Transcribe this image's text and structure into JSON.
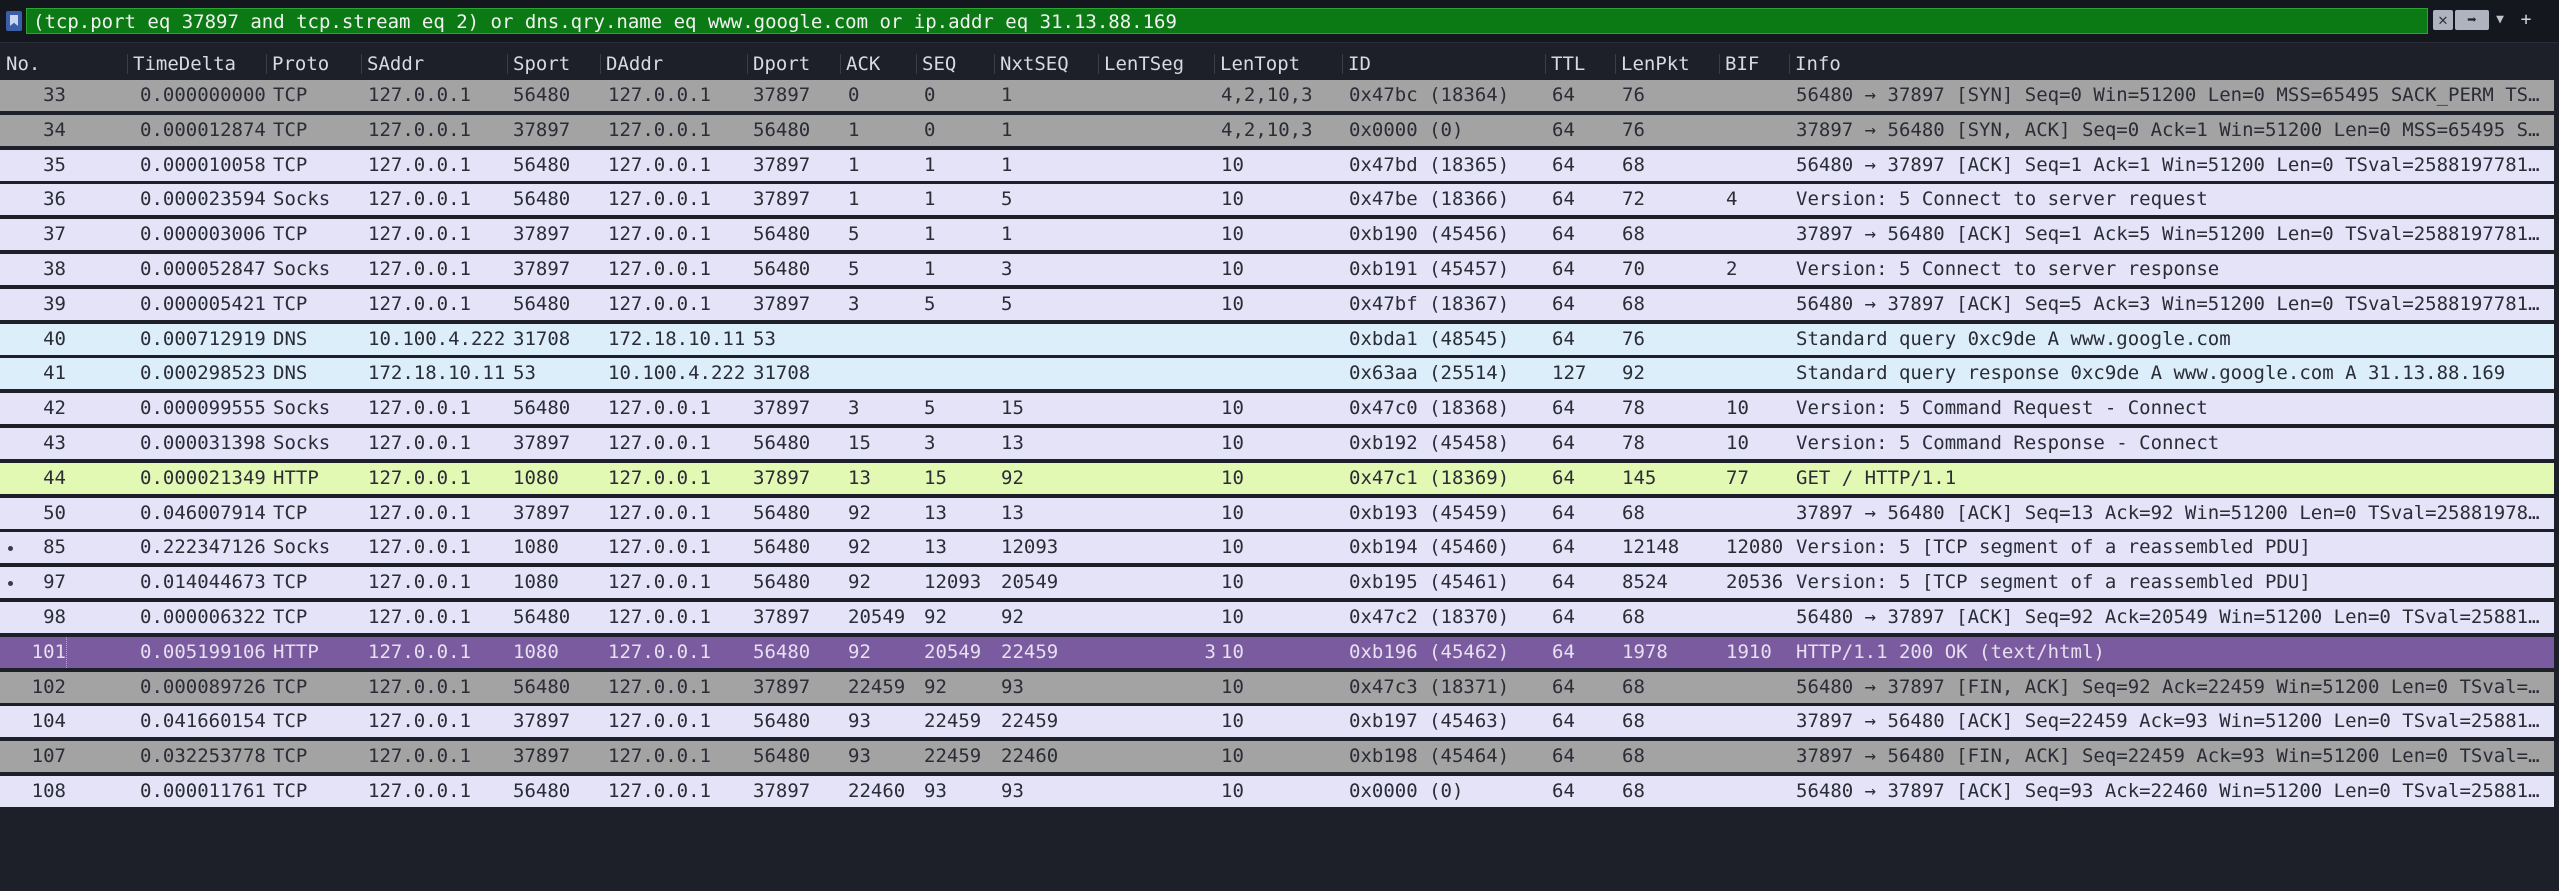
{
  "filter": {
    "value": "(tcp.port eq 37897 and tcp.stream eq 2) or dns.qry.name eq www.google.com or ip.addr eq 31.13.88.169",
    "clear_icon": "clear-icon",
    "apply_icon": "apply-arrow-icon",
    "dropdown_icon": "chevron-down-icon",
    "add_icon": "plus-icon"
  },
  "columns": [
    "No.",
    "TimeDelta",
    "Proto",
    "SAddr",
    "Sport",
    "DAddr",
    "Dport",
    "ACK",
    "SEQ",
    "NxtSEQ",
    "LenTSeg",
    "LenTopt",
    "ID",
    "TTL",
    "LenPkt",
    "BIF",
    "Info"
  ],
  "colors": {
    "tcp": "#e4e3f8",
    "tcp_syn_fin": "#a3a3a3",
    "dns": "#dbeefa",
    "http": "#e2f9b4",
    "selected": "#7a5ba0",
    "filter_valid": "#0c7a14"
  },
  "packets": [
    {
      "no": "33",
      "td": "0.000000000",
      "proto": "TCP",
      "saddr": "127.0.0.1",
      "sport": "56480",
      "daddr": "127.0.0.1",
      "dport": "37897",
      "ack": "0",
      "seq": "0",
      "nxt": "1",
      "lents": "",
      "lento": "4,2,10,3",
      "id": "0x47bc (18364)",
      "ttl": "64",
      "lenpkt": "76",
      "bif": "",
      "info": "56480 → 37897 [SYN] Seq=0 Win=51200 Len=0 MSS=65495 SACK_PERM TS…",
      "style": "syn",
      "mark": false
    },
    {
      "no": "34",
      "td": "0.000012874",
      "proto": "TCP",
      "saddr": "127.0.0.1",
      "sport": "37897",
      "daddr": "127.0.0.1",
      "dport": "56480",
      "ack": "1",
      "seq": "0",
      "nxt": "1",
      "lents": "",
      "lento": "4,2,10,3",
      "id": "0x0000 (0)",
      "ttl": "64",
      "lenpkt": "76",
      "bif": "",
      "info": "37897 → 56480 [SYN, ACK] Seq=0 Ack=1 Win=51200 Len=0 MSS=65495 S…",
      "style": "syn",
      "mark": false
    },
    {
      "no": "35",
      "td": "0.000010058",
      "proto": "TCP",
      "saddr": "127.0.0.1",
      "sport": "56480",
      "daddr": "127.0.0.1",
      "dport": "37897",
      "ack": "1",
      "seq": "1",
      "nxt": "1",
      "lents": "",
      "lento": "10",
      "id": "0x47bd (18365)",
      "ttl": "64",
      "lenpkt": "68",
      "bif": "",
      "info": "56480 → 37897 [ACK] Seq=1 Ack=1 Win=51200 Len=0 TSval=2588197781…",
      "style": "tcp",
      "mark": false
    },
    {
      "no": "36",
      "td": "0.000023594",
      "proto": "Socks",
      "saddr": "127.0.0.1",
      "sport": "56480",
      "daddr": "127.0.0.1",
      "dport": "37897",
      "ack": "1",
      "seq": "1",
      "nxt": "5",
      "lents": "",
      "lento": "10",
      "id": "0x47be (18366)",
      "ttl": "64",
      "lenpkt": "72",
      "bif": "4",
      "info": "Version: 5 Connect to server request",
      "style": "tcp",
      "mark": false
    },
    {
      "no": "37",
      "td": "0.000003006",
      "proto": "TCP",
      "saddr": "127.0.0.1",
      "sport": "37897",
      "daddr": "127.0.0.1",
      "dport": "56480",
      "ack": "5",
      "seq": "1",
      "nxt": "1",
      "lents": "",
      "lento": "10",
      "id": "0xb190 (45456)",
      "ttl": "64",
      "lenpkt": "68",
      "bif": "",
      "info": "37897 → 56480 [ACK] Seq=1 Ack=5 Win=51200 Len=0 TSval=2588197781…",
      "style": "tcp",
      "mark": false
    },
    {
      "no": "38",
      "td": "0.000052847",
      "proto": "Socks",
      "saddr": "127.0.0.1",
      "sport": "37897",
      "daddr": "127.0.0.1",
      "dport": "56480",
      "ack": "5",
      "seq": "1",
      "nxt": "3",
      "lents": "",
      "lento": "10",
      "id": "0xb191 (45457)",
      "ttl": "64",
      "lenpkt": "70",
      "bif": "2",
      "info": "Version: 5 Connect to server response",
      "style": "tcp",
      "mark": false
    },
    {
      "no": "39",
      "td": "0.000005421",
      "proto": "TCP",
      "saddr": "127.0.0.1",
      "sport": "56480",
      "daddr": "127.0.0.1",
      "dport": "37897",
      "ack": "3",
      "seq": "5",
      "nxt": "5",
      "lents": "",
      "lento": "10",
      "id": "0x47bf (18367)",
      "ttl": "64",
      "lenpkt": "68",
      "bif": "",
      "info": "56480 → 37897 [ACK] Seq=5 Ack=3 Win=51200 Len=0 TSval=2588197781…",
      "style": "tcp",
      "mark": false
    },
    {
      "no": "40",
      "td": "0.000712919",
      "proto": "DNS",
      "saddr": "10.100.4.222",
      "sport": "31708",
      "daddr": "172.18.10.11",
      "dport": "53",
      "ack": "",
      "seq": "",
      "nxt": "",
      "lents": "",
      "lento": "",
      "id": "0xbda1 (48545)",
      "ttl": "64",
      "lenpkt": "76",
      "bif": "",
      "info": "Standard query 0xc9de A www.google.com",
      "style": "dns",
      "mark": false
    },
    {
      "no": "41",
      "td": "0.000298523",
      "proto": "DNS",
      "saddr": "172.18.10.11",
      "sport": "53",
      "daddr": "10.100.4.222",
      "dport": "31708",
      "ack": "",
      "seq": "",
      "nxt": "",
      "lents": "",
      "lento": "",
      "id": "0x63aa (25514)",
      "ttl": "127",
      "lenpkt": "92",
      "bif": "",
      "info": "Standard query response 0xc9de A www.google.com A 31.13.88.169",
      "style": "dns",
      "mark": false
    },
    {
      "no": "42",
      "td": "0.000099555",
      "proto": "Socks",
      "saddr": "127.0.0.1",
      "sport": "56480",
      "daddr": "127.0.0.1",
      "dport": "37897",
      "ack": "3",
      "seq": "5",
      "nxt": "15",
      "lents": "",
      "lento": "10",
      "id": "0x47c0 (18368)",
      "ttl": "64",
      "lenpkt": "78",
      "bif": "10",
      "info": "Version: 5 Command Request - Connect",
      "style": "tcp",
      "mark": false
    },
    {
      "no": "43",
      "td": "0.000031398",
      "proto": "Socks",
      "saddr": "127.0.0.1",
      "sport": "37897",
      "daddr": "127.0.0.1",
      "dport": "56480",
      "ack": "15",
      "seq": "3",
      "nxt": "13",
      "lents": "",
      "lento": "10",
      "id": "0xb192 (45458)",
      "ttl": "64",
      "lenpkt": "78",
      "bif": "10",
      "info": "Version: 5 Command Response - Connect",
      "style": "tcp",
      "mark": false
    },
    {
      "no": "44",
      "td": "0.000021349",
      "proto": "HTTP",
      "saddr": "127.0.0.1",
      "sport": "1080",
      "daddr": "127.0.0.1",
      "dport": "37897",
      "ack": "13",
      "seq": "15",
      "nxt": "92",
      "lents": "",
      "lento": "10",
      "id": "0x47c1 (18369)",
      "ttl": "64",
      "lenpkt": "145",
      "bif": "77",
      "info": "GET / HTTP/1.1",
      "style": "http",
      "mark": false
    },
    {
      "no": "50",
      "td": "0.046007914",
      "proto": "TCP",
      "saddr": "127.0.0.1",
      "sport": "37897",
      "daddr": "127.0.0.1",
      "dport": "56480",
      "ack": "92",
      "seq": "13",
      "nxt": "13",
      "lents": "",
      "lento": "10",
      "id": "0xb193 (45459)",
      "ttl": "64",
      "lenpkt": "68",
      "bif": "",
      "info": "37897 → 56480 [ACK] Seq=13 Ack=92 Win=51200 Len=0 TSval=25881978…",
      "style": "tcp",
      "mark": false
    },
    {
      "no": "85",
      "td": "0.222347126",
      "proto": "Socks",
      "saddr": "127.0.0.1",
      "sport": "1080",
      "daddr": "127.0.0.1",
      "dport": "56480",
      "ack": "92",
      "seq": "13",
      "nxt": "12093",
      "lents": "",
      "lento": "10",
      "id": "0xb194 (45460)",
      "ttl": "64",
      "lenpkt": "12148",
      "bif": "12080",
      "info": "Version: 5 [TCP segment of a reassembled PDU]",
      "style": "tcp",
      "mark": true
    },
    {
      "no": "97",
      "td": "0.014044673",
      "proto": "TCP",
      "saddr": "127.0.0.1",
      "sport": "1080",
      "daddr": "127.0.0.1",
      "dport": "56480",
      "ack": "92",
      "seq": "12093",
      "nxt": "20549",
      "lents": "",
      "lento": "10",
      "id": "0xb195 (45461)",
      "ttl": "64",
      "lenpkt": "8524",
      "bif": "20536",
      "info": "Version: 5 [TCP segment of a reassembled PDU]",
      "style": "tcp",
      "mark": true
    },
    {
      "no": "98",
      "td": "0.000006322",
      "proto": "TCP",
      "saddr": "127.0.0.1",
      "sport": "56480",
      "daddr": "127.0.0.1",
      "dport": "37897",
      "ack": "20549",
      "seq": "92",
      "nxt": "92",
      "lents": "",
      "lento": "10",
      "id": "0x47c2 (18370)",
      "ttl": "64",
      "lenpkt": "68",
      "bif": "",
      "info": "56480 → 37897 [ACK] Seq=92 Ack=20549 Win=51200 Len=0 TSval=25881…",
      "style": "tcp",
      "mark": false
    },
    {
      "no": "101",
      "td": "0.005199106",
      "proto": "HTTP",
      "saddr": "127.0.0.1",
      "sport": "1080",
      "daddr": "127.0.0.1",
      "dport": "56480",
      "ack": "92",
      "seq": "20549",
      "nxt": "22459",
      "lents": "3",
      "lento": "10",
      "id": "0xb196 (45462)",
      "ttl": "64",
      "lenpkt": "1978",
      "bif": "1910",
      "info": "HTTP/1.1 200 OK  (text/html)",
      "style": "sel",
      "mark": false
    },
    {
      "no": "102",
      "td": "0.000089726",
      "proto": "TCP",
      "saddr": "127.0.0.1",
      "sport": "56480",
      "daddr": "127.0.0.1",
      "dport": "37897",
      "ack": "22459",
      "seq": "92",
      "nxt": "93",
      "lents": "",
      "lento": "10",
      "id": "0x47c3 (18371)",
      "ttl": "64",
      "lenpkt": "68",
      "bif": "",
      "info": "56480 → 37897 [FIN, ACK] Seq=92 Ack=22459 Win=51200 Len=0 TSval=…",
      "style": "syn",
      "mark": false
    },
    {
      "no": "104",
      "td": "0.041660154",
      "proto": "TCP",
      "saddr": "127.0.0.1",
      "sport": "37897",
      "daddr": "127.0.0.1",
      "dport": "56480",
      "ack": "93",
      "seq": "22459",
      "nxt": "22459",
      "lents": "",
      "lento": "10",
      "id": "0xb197 (45463)",
      "ttl": "64",
      "lenpkt": "68",
      "bif": "",
      "info": "37897 → 56480 [ACK] Seq=22459 Ack=93 Win=51200 Len=0 TSval=25881…",
      "style": "tcp",
      "mark": false
    },
    {
      "no": "107",
      "td": "0.032253778",
      "proto": "TCP",
      "saddr": "127.0.0.1",
      "sport": "37897",
      "daddr": "127.0.0.1",
      "dport": "56480",
      "ack": "93",
      "seq": "22459",
      "nxt": "22460",
      "lents": "",
      "lento": "10",
      "id": "0xb198 (45464)",
      "ttl": "64",
      "lenpkt": "68",
      "bif": "",
      "info": "37897 → 56480 [FIN, ACK] Seq=22459 Ack=93 Win=51200 Len=0 TSval=…",
      "style": "syn",
      "mark": false
    },
    {
      "no": "108",
      "td": "0.000011761",
      "proto": "TCP",
      "saddr": "127.0.0.1",
      "sport": "56480",
      "daddr": "127.0.0.1",
      "dport": "37897",
      "ack": "22460",
      "seq": "93",
      "nxt": "93",
      "lents": "",
      "lento": "10",
      "id": "0x0000 (0)",
      "ttl": "64",
      "lenpkt": "68",
      "bif": "",
      "info": "56480 → 37897 [ACK] Seq=93 Ack=22460 Win=51200 Len=0 TSval=25881…",
      "style": "tcp",
      "mark": false
    }
  ]
}
